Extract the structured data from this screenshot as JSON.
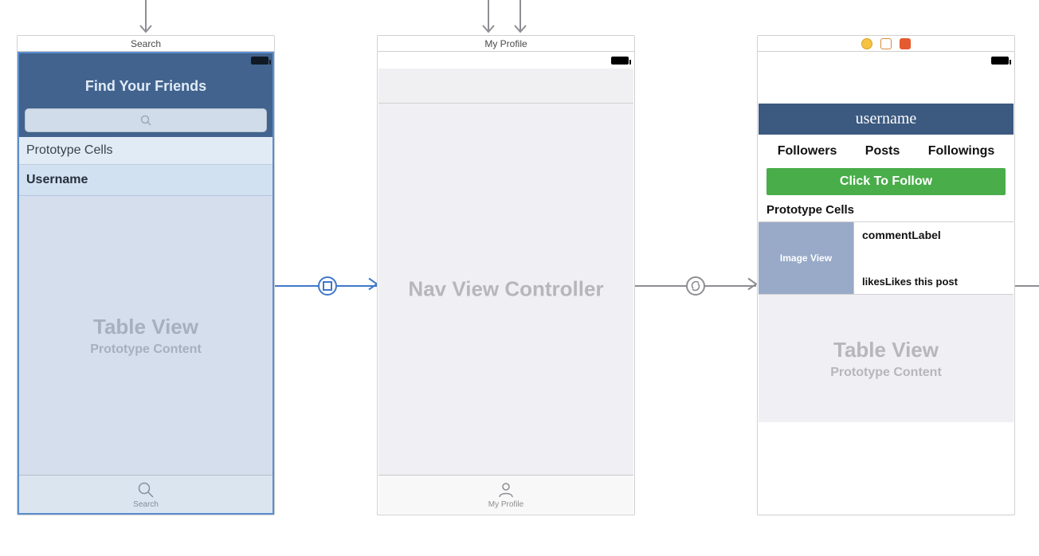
{
  "scene1": {
    "title": "Search",
    "nav_title": "Find Your Friends",
    "proto_header": "Prototype Cells",
    "cell_label": "Username",
    "placeholder_title": "Table View",
    "placeholder_sub": "Prototype Content",
    "tab_label": "Search"
  },
  "scene2": {
    "title": "My Profile",
    "body_text": "Nav View Controller",
    "tab_label": "My Profile"
  },
  "scene3": {
    "username_header": "username",
    "stats": {
      "followers": "Followers",
      "posts": "Posts",
      "followings": "Followings"
    },
    "follow_btn": "Click To Follow",
    "proto_header": "Prototype Cells",
    "image_view": "Image View",
    "comment_label": "commentLabel",
    "likes_count": "likes",
    "likes_text": "Likes this post",
    "placeholder_title": "Table View",
    "placeholder_sub": "Prototype Content"
  }
}
